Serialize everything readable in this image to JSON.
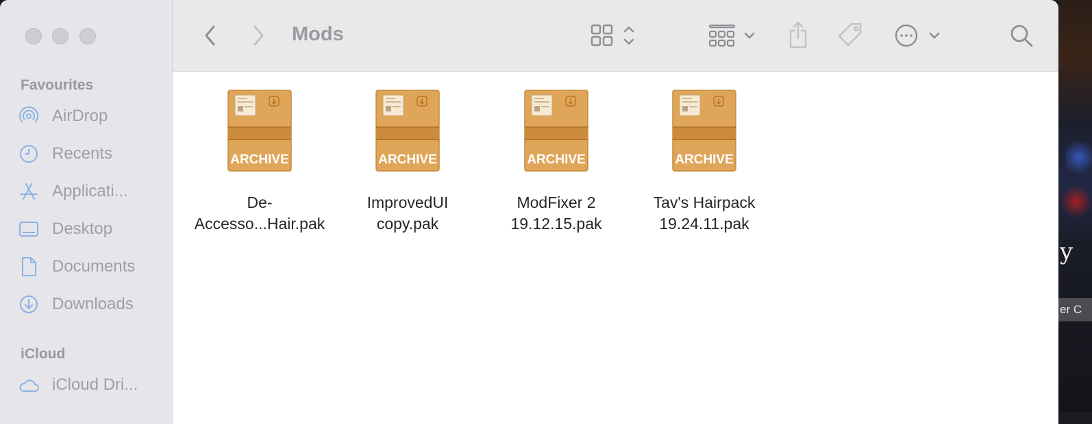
{
  "window": {
    "title": "Mods"
  },
  "sidebar": {
    "sections": [
      {
        "label": "Favourites",
        "items": [
          {
            "label": "AirDrop",
            "icon": "airdrop-icon"
          },
          {
            "label": "Recents",
            "icon": "clock-icon"
          },
          {
            "label": "Applicati...",
            "icon": "applications-icon"
          },
          {
            "label": "Desktop",
            "icon": "desktop-icon"
          },
          {
            "label": "Documents",
            "icon": "document-icon"
          },
          {
            "label": "Downloads",
            "icon": "download-icon"
          }
        ]
      },
      {
        "label": "iCloud",
        "items": [
          {
            "label": "iCloud Dri...",
            "icon": "cloud-icon"
          }
        ]
      }
    ]
  },
  "toolbar": {
    "back_icon": "chevron-left-icon",
    "forward_icon": "chevron-right-icon",
    "view_icon": "icon-grid-view-icon",
    "group_icon": "group-by-icon",
    "share_icon": "share-icon",
    "tag_icon": "tag-icon",
    "more_icon": "ellipsis-circle-icon",
    "search_icon": "search-icon"
  },
  "files": [
    {
      "line1": "De-",
      "line2": "Accesso...Hair.pak",
      "badge": "ARCHIVE"
    },
    {
      "line1": "ImprovedUI",
      "line2": "copy.pak",
      "badge": "ARCHIVE"
    },
    {
      "line1": "ModFixer 2",
      "line2": "19.12.15.pak",
      "badge": "ARCHIVE"
    },
    {
      "line1": "Tav's Hairpack",
      "line2": "19.24.11.pak",
      "badge": "ARCHIVE"
    }
  ],
  "desktop": {
    "fragment_text": "y",
    "fragment_chip": "er C"
  },
  "colors": {
    "sidebar_bg": "#e6e5e9",
    "archive_orange": "#dfa659",
    "archive_stripe": "#c78435"
  }
}
